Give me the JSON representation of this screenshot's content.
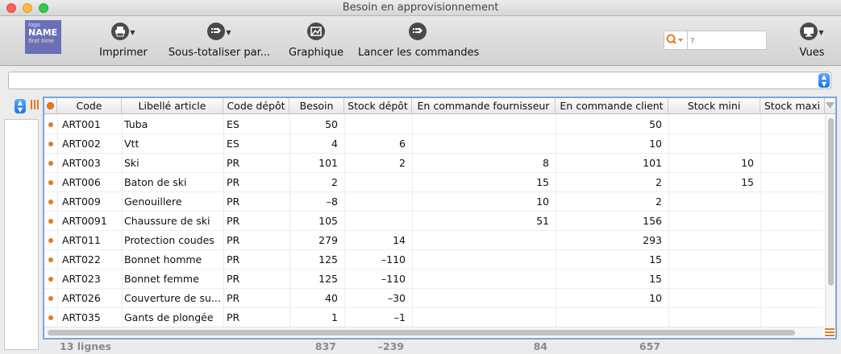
{
  "window": {
    "title": "Besoin en approvisionnement"
  },
  "logo": {
    "line1": "logo",
    "line2": "NAME",
    "line3": "first time"
  },
  "toolbar": {
    "buttons": [
      {
        "label": "Imprimer",
        "icon": "printer-icon",
        "has_menu": true
      },
      {
        "label": "Sous-totaliser par...",
        "icon": "subtotal-icon",
        "has_menu": true
      },
      {
        "label": "Graphique",
        "icon": "chart-icon",
        "has_menu": false
      },
      {
        "label": "Lancer les commandes",
        "icon": "launch-orders-icon",
        "has_menu": false
      },
      {
        "label": "Vues",
        "icon": "monitor-icon",
        "has_menu": true
      }
    ]
  },
  "search": {
    "placeholder": "?",
    "value": "",
    "icon": "search-icon"
  },
  "filter": {
    "value": ""
  },
  "table": {
    "columns": [
      "Code",
      "Libellé article",
      "Code dépôt",
      "Besoin",
      "Stock dépôt",
      "En commande fournisseur",
      "En commande client",
      "Stock mini",
      "Stock maxi"
    ],
    "sorted_column": "Code",
    "sort_direction": "ascending",
    "rows": [
      {
        "code": "ART001",
        "label": "Tuba",
        "depot": "ES",
        "besoin": "50",
        "stock_depot": "",
        "cmd_fournisseur": "",
        "cmd_client": "50",
        "stock_mini": "",
        "stock_maxi": ""
      },
      {
        "code": "ART002",
        "label": "Vtt",
        "depot": "ES",
        "besoin": "4",
        "stock_depot": "6",
        "cmd_fournisseur": "",
        "cmd_client": "10",
        "stock_mini": "",
        "stock_maxi": ""
      },
      {
        "code": "ART003",
        "label": "Ski",
        "depot": "PR",
        "besoin": "101",
        "stock_depot": "2",
        "cmd_fournisseur": "8",
        "cmd_client": "101",
        "stock_mini": "10",
        "stock_maxi": ""
      },
      {
        "code": "ART006",
        "label": "Baton de ski",
        "depot": "PR",
        "besoin": "2",
        "stock_depot": "",
        "cmd_fournisseur": "15",
        "cmd_client": "2",
        "stock_mini": "15",
        "stock_maxi": ""
      },
      {
        "code": "ART009",
        "label": "Genouillere",
        "depot": "PR",
        "besoin": "–8",
        "stock_depot": "",
        "cmd_fournisseur": "10",
        "cmd_client": "2",
        "stock_mini": "",
        "stock_maxi": ""
      },
      {
        "code": "ART0091",
        "label": "Chaussure de ski",
        "depot": "PR",
        "besoin": "105",
        "stock_depot": "",
        "cmd_fournisseur": "51",
        "cmd_client": "156",
        "stock_mini": "",
        "stock_maxi": ""
      },
      {
        "code": "ART011",
        "label": "Protection coudes",
        "depot": "PR",
        "besoin": "279",
        "stock_depot": "14",
        "cmd_fournisseur": "",
        "cmd_client": "293",
        "stock_mini": "",
        "stock_maxi": ""
      },
      {
        "code": "ART022",
        "label": "Bonnet homme",
        "depot": "PR",
        "besoin": "125",
        "stock_depot": "–110",
        "cmd_fournisseur": "",
        "cmd_client": "15",
        "stock_mini": "",
        "stock_maxi": ""
      },
      {
        "code": "ART023",
        "label": "Bonnet femme",
        "depot": "PR",
        "besoin": "125",
        "stock_depot": "–110",
        "cmd_fournisseur": "",
        "cmd_client": "15",
        "stock_mini": "",
        "stock_maxi": ""
      },
      {
        "code": "ART026",
        "label": "Couverture de su...",
        "depot": "PR",
        "besoin": "40",
        "stock_depot": "–30",
        "cmd_fournisseur": "",
        "cmd_client": "10",
        "stock_mini": "",
        "stock_maxi": ""
      },
      {
        "code": "ART035",
        "label": "Gants de plongée",
        "depot": "PR",
        "besoin": "1",
        "stock_depot": "–1",
        "cmd_fournisseur": "",
        "cmd_client": "",
        "stock_mini": "",
        "stock_maxi": ""
      }
    ]
  },
  "footer": {
    "count": "13 lignes",
    "besoin": "837",
    "stock_depot": "–239",
    "cmd_fournisseur": "84",
    "cmd_client": "657"
  },
  "colors": {
    "accent": "#e8791f",
    "selection_border": "#7aa6df",
    "logo_bg": "#6a6fb7"
  }
}
